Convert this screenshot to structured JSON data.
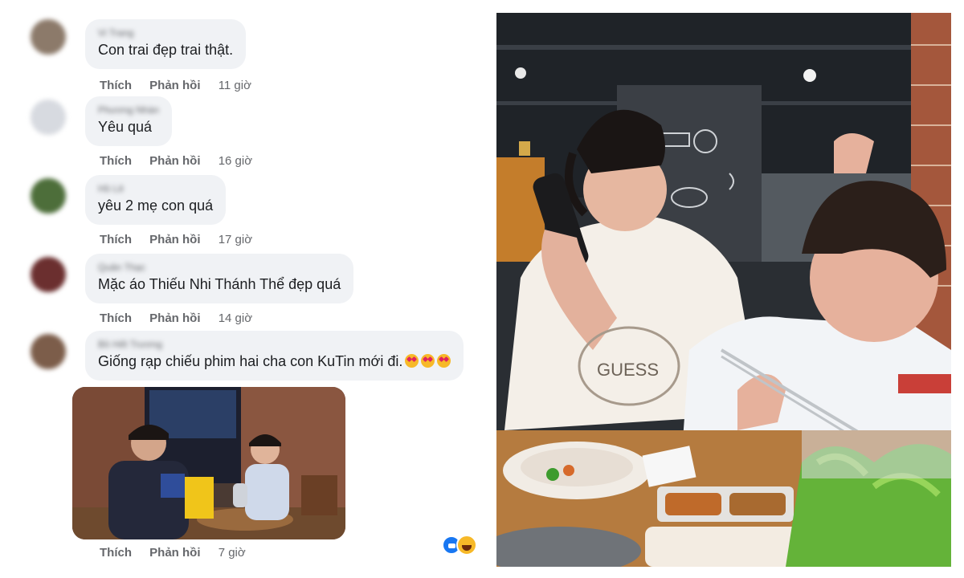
{
  "comments": [
    {
      "author": "Vi Trang",
      "text": "Con trai đẹp trai thật.",
      "like_label": "Thích",
      "reply_label": "Phản hồi",
      "time": "11 giờ",
      "avatar_color": "#8c7a6a"
    },
    {
      "author": "Phương Nhàn",
      "text": "Yêu quá",
      "like_label": "Thích",
      "reply_label": "Phản hồi",
      "time": "16 giờ",
      "avatar_color": "#d7dae0"
    },
    {
      "author": "Hồ Lê",
      "text": "yêu 2 mẹ con quá",
      "like_label": "Thích",
      "reply_label": "Phản hồi",
      "time": "17 giờ",
      "avatar_color": "#4d6e3a"
    },
    {
      "author": "Quân Thạc",
      "text": "Mặc áo Thiếu Nhi Thánh Thể đẹp quá",
      "like_label": "Thích",
      "reply_label": "Phản hồi",
      "time": "14 giờ",
      "avatar_color": "#6b2f2f"
    },
    {
      "author": "Bồ Hết Trương",
      "text": "Giống rạp chiếu phim hai cha con KuTin mới đi.",
      "emojis": [
        "heart-eyes-emoji",
        "heart-eyes-emoji",
        "heart-eyes-emoji"
      ],
      "like_label": "Thích",
      "reply_label": "Phản hồi",
      "time": "7 giờ",
      "avatar_color": "#7c5d4a"
    }
  ],
  "attachment_reactions": [
    "like-reaction-icon",
    "haha-reaction-icon"
  ],
  "colors": {
    "bubble_bg": "#f0f2f5",
    "action_text": "#65676b",
    "comment_text": "#1c1e21",
    "like_blue": "#1877f2"
  },
  "photo": {
    "shirt_text": "GUESS"
  }
}
